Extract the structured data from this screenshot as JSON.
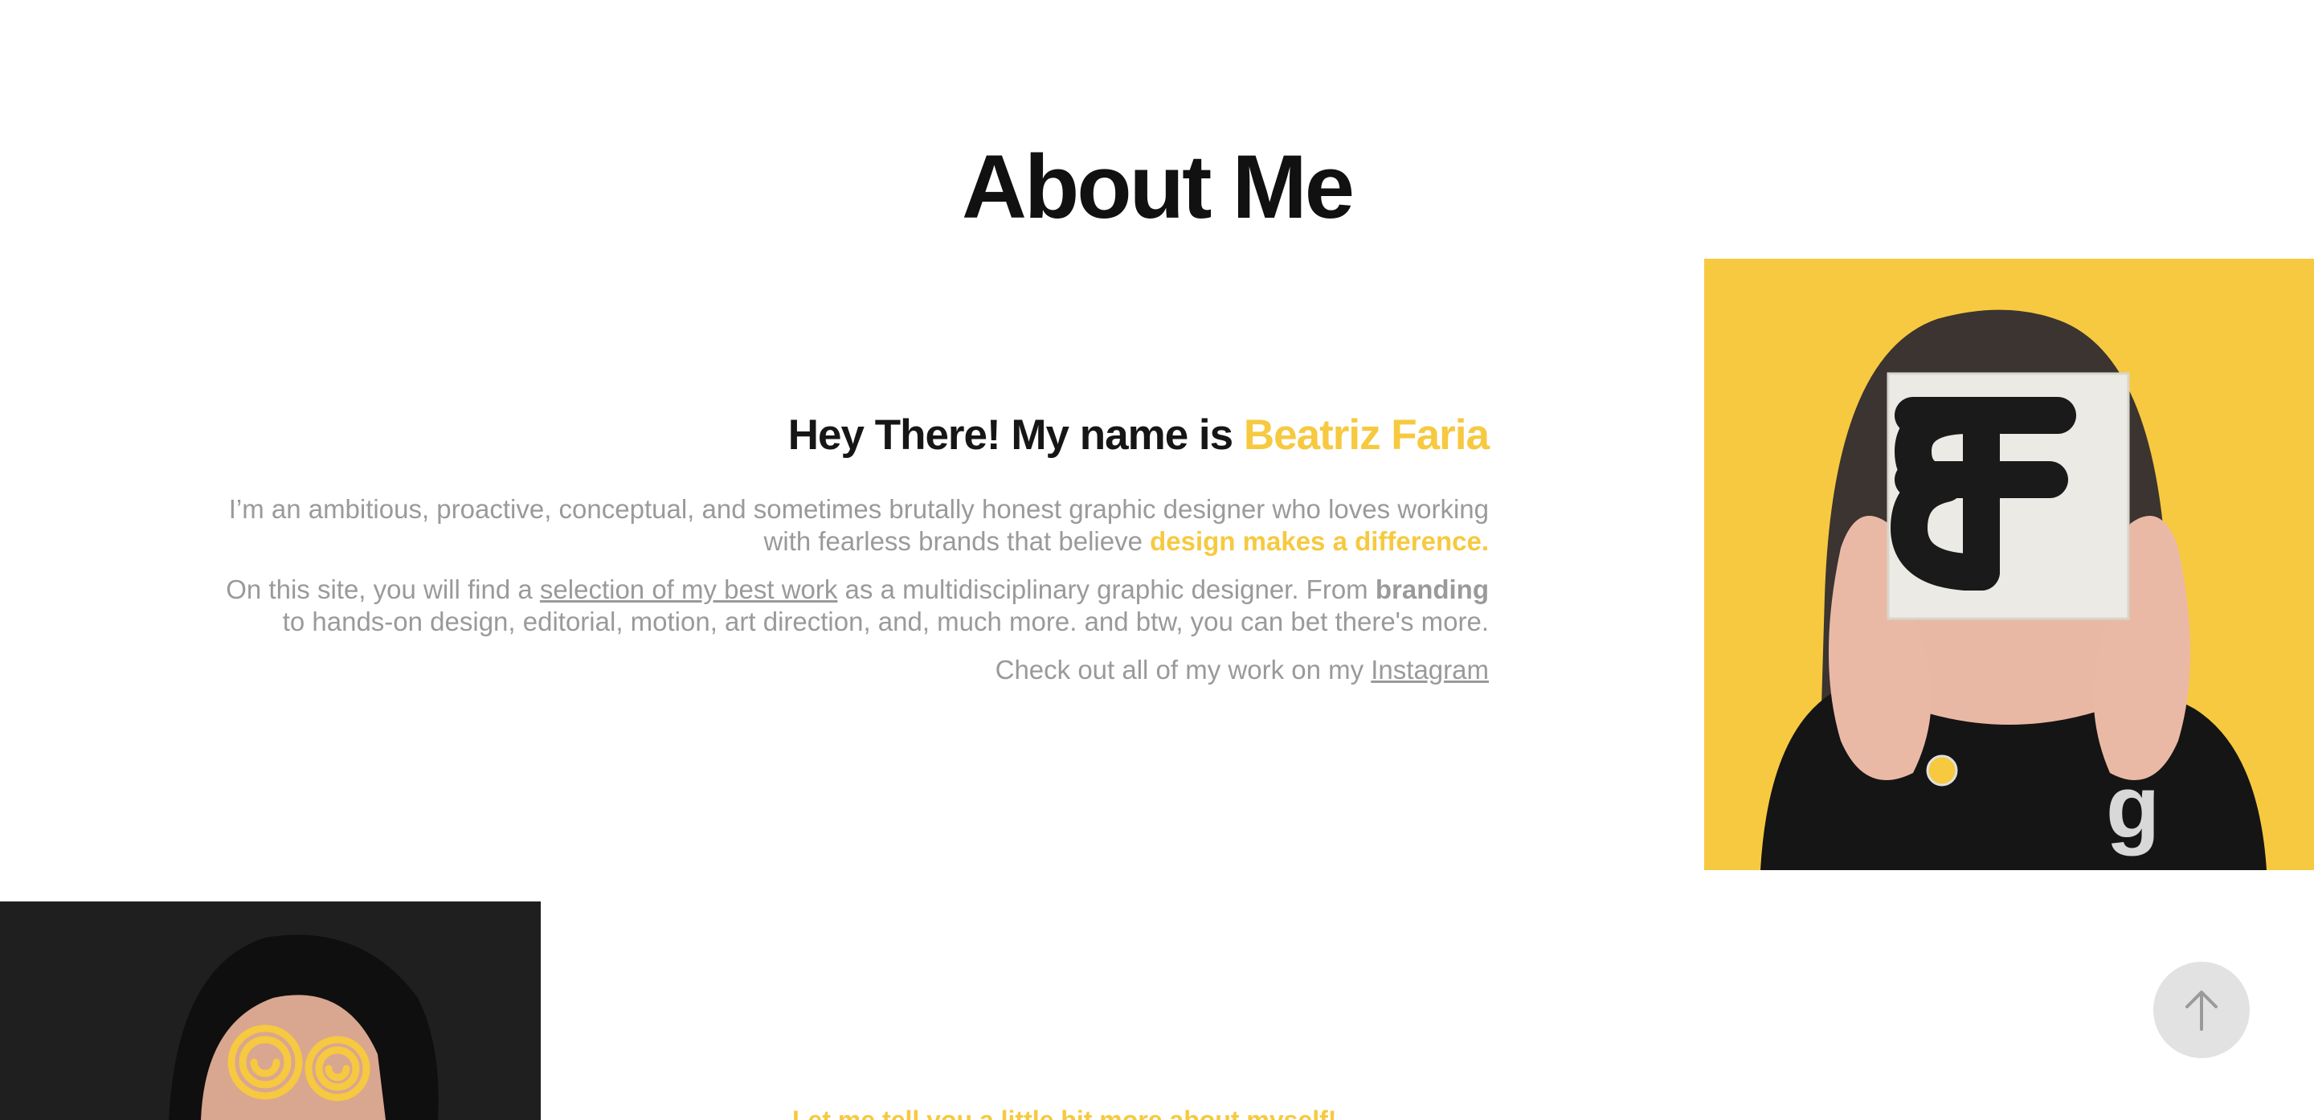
{
  "page": {
    "title": "About Me"
  },
  "intro": {
    "greeting_prefix": "Hey There! My name is ",
    "greeting_name": "Beatriz Faria",
    "p1_text": "I’m an ambitious, proactive, conceptual, and sometimes brutally honest graphic designer who loves working with fearless brands that believe ",
    "p1_highlight": "design makes a difference.",
    "p2_prefix": "On this site, you will find a ",
    "p2_link": "selection of my best work",
    "p2_middle": " as a multidisciplinary graphic designer. From ",
    "p2_bold": "branding",
    "p2_suffix": " to hands-on design, editorial, motion, art direction, and, much more. and btw, you can bet there's more. ",
    "p3_prefix": "Check out all of my work on my ",
    "p3_link": "Instagram"
  },
  "more": {
    "text": "Let me tell you a little bit more about myself!"
  },
  "colors": {
    "accent": "#f6c940",
    "text_dark": "#161616",
    "text_muted": "#9a9a9a",
    "dark_panel": "#1f1f1f",
    "button_bg": "#e2e2e2"
  },
  "icons": {
    "scroll_top": "arrow-up-icon"
  }
}
